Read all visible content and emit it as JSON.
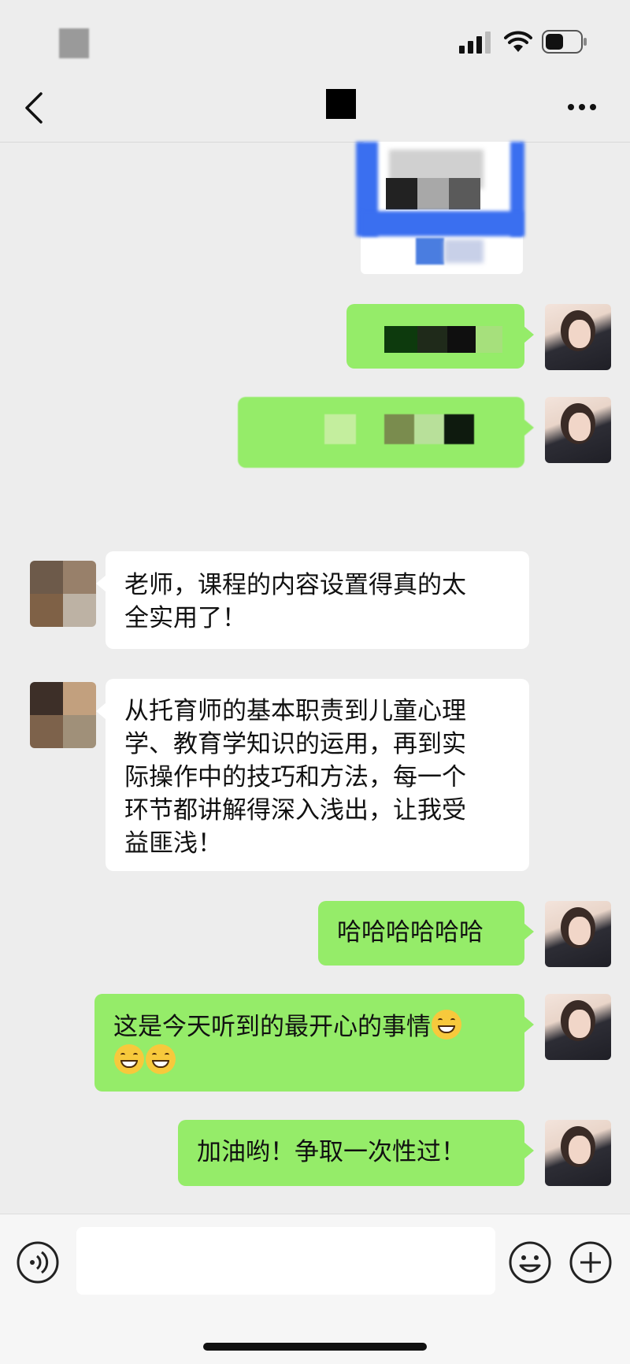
{
  "chat": {
    "messages": [
      {
        "id": "m5",
        "side": "left",
        "text": "老师，课程的内容设置得真的太全实用了！"
      },
      {
        "id": "m6",
        "side": "left",
        "text": "从托育师的基本职责到儿童心理学、教育学知识的运用，再到实际操作中的技巧和方法，每一个环节都讲解得深入浅出，让我受益匪浅！"
      },
      {
        "id": "m7",
        "side": "right",
        "text": "哈哈哈哈哈哈"
      },
      {
        "id": "m8",
        "side": "right",
        "text": "这是今天听到的最开心的事情"
      },
      {
        "id": "m9",
        "side": "right",
        "text": "加油哟！争取一次性过！"
      }
    ],
    "line1_a": "老师，课程的内容设置得真的太",
    "line1_b": "全实用了！",
    "line2": [
      "从托育师的基本职责到儿童心理",
      "学、教育学知识的运用，再到实",
      "际操作中的技巧和方法，每一个",
      "环节都讲解得深入浅出，让我受",
      "益匪浅！"
    ]
  },
  "bottom": {
    "input_placeholder": ""
  },
  "icons": {
    "back": "chevron-left-icon",
    "more": "more-dots-icon",
    "voice": "voice-icon",
    "emoji": "emoji-icon",
    "plus": "plus-icon"
  },
  "colors": {
    "green_bubble": "#95ec69",
    "background": "#ededed"
  }
}
